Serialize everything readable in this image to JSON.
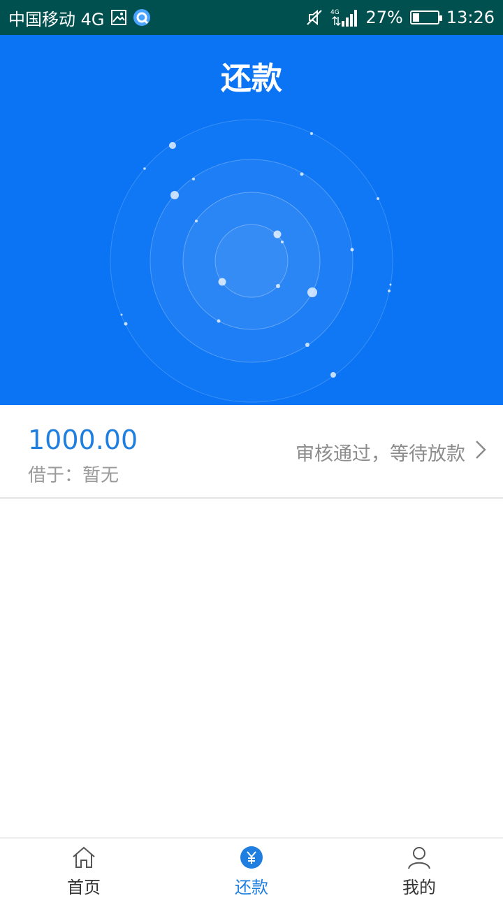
{
  "status_bar": {
    "carrier": "中国移动 4G",
    "battery": "27%",
    "battery_level": 0.27,
    "time": "13:26",
    "network_label": "4G"
  },
  "header": {
    "title": "还款"
  },
  "loan": {
    "amount": "1000.00",
    "borrow_label": "借于：",
    "borrow_value": "暂无",
    "status_text": "审核通过，等待放款"
  },
  "nav": {
    "items": [
      {
        "label": "首页",
        "icon": "home-icon",
        "active": false
      },
      {
        "label": "还款",
        "icon": "repay-yuan-icon",
        "active": true
      },
      {
        "label": "我的",
        "icon": "user-icon",
        "active": false
      }
    ]
  },
  "colors": {
    "status_bar": "#00504f",
    "header_bg": "#0a74f5",
    "accent": "#1e7fe0",
    "muted_text": "#9a9a9a"
  }
}
